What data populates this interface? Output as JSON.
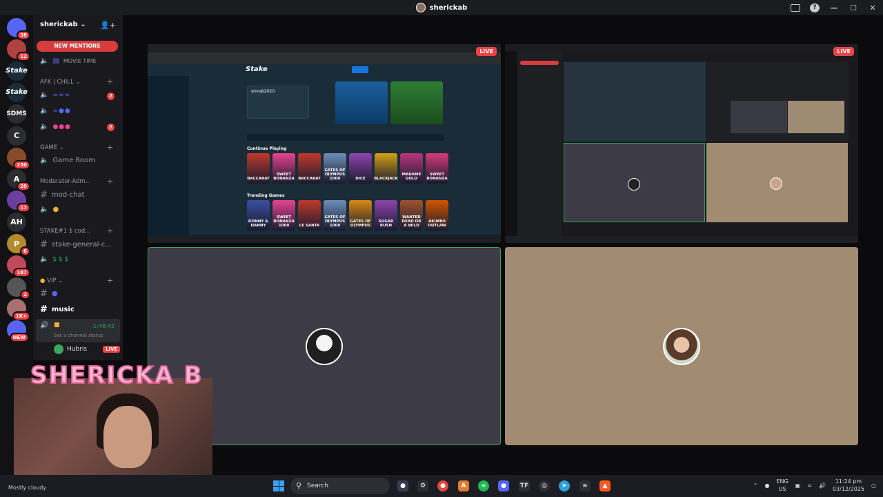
{
  "window": {
    "title": "sherickab"
  },
  "server": {
    "name": "sherickab",
    "new_mentions": "NEW MENTIONS"
  },
  "rail": [
    {
      "label": "",
      "badge": "38",
      "color": "#5865f2"
    },
    {
      "label": "",
      "badge": "12",
      "color": "#b34040"
    },
    {
      "label": "Stake",
      "badge": "",
      "color": "#1a2c38"
    },
    {
      "label": "Stake",
      "badge": "",
      "color": "#1a2c38"
    },
    {
      "label": "SDMS",
      "badge": "",
      "color": "#2b2d31"
    },
    {
      "label": "C",
      "badge": "",
      "color": "#2b2d31"
    },
    {
      "label": "",
      "badge": "230",
      "color": "#8a4b2b"
    },
    {
      "label": "A",
      "badge": "20",
      "color": "#2b2d31"
    },
    {
      "label": "",
      "badge": "17",
      "color": "#6b3fa0"
    },
    {
      "label": "AH",
      "badge": "",
      "color": "#2b2d31"
    },
    {
      "label": "P",
      "badge": "6",
      "color": "#b48a2a"
    },
    {
      "label": "",
      "badge": "187",
      "color": "#c04a5a"
    },
    {
      "label": "",
      "badge": "2",
      "color": "#555"
    },
    {
      "label": "",
      "badge": "1K+",
      "color": "#a87070"
    },
    {
      "label": "",
      "badge": "NEW",
      "color": "#5865f2"
    }
  ],
  "channels": {
    "movie_time": "MOVIE TIME",
    "afk_category": "AFK | CHILL",
    "game_category": "GAME",
    "game_room": "Game Room",
    "mod_category": "Moderator-Adm...",
    "mod_chat": "mod-chat",
    "stake_category": "STAKE#1 $ cod...",
    "stake_general": "stake-general-c...",
    "vip_category": "VIP",
    "music": "music",
    "timer": "1:48:43",
    "channel_status": "Set a channel status",
    "hubris_name": "Hubris",
    "hubris_live": "LIVE",
    "afk_badge_1": "2",
    "afk_badge_2": "2"
  },
  "streams": {
    "live_label": "LIVE",
    "stake_username": "smrab2020",
    "continue_playing": "Continue Playing",
    "trending": "Trending Games",
    "games_row1": [
      {
        "name": "BACCARAT",
        "color": "#c0392b"
      },
      {
        "name": "SWEET BONANZA",
        "color": "#e84393"
      },
      {
        "name": "BACCARAT",
        "color": "#c0392b"
      },
      {
        "name": "GATES OF OLYMPUS 1000",
        "color": "#6c8fb8"
      },
      {
        "name": "DICE",
        "color": "#8e44ad"
      },
      {
        "name": "BLACKJACK",
        "color": "#d4a017"
      },
      {
        "name": "MADAME GOLD",
        "color": "#b8367d"
      },
      {
        "name": "SWEET BONANZA",
        "color": "#d63a7a"
      }
    ],
    "games_row2": [
      {
        "name": "DONNY & DANNY",
        "color": "#3a4fa0"
      },
      {
        "name": "SWEET BONANZA 1000",
        "color": "#e84393"
      },
      {
        "name": "LE SANTA",
        "color": "#c0392b"
      },
      {
        "name": "GATES OF OLYMPUS 1000",
        "color": "#6c8fb8"
      },
      {
        "name": "GATES OF OLYMPUS",
        "color": "#d68910"
      },
      {
        "name": "SUGAR RUSH",
        "color": "#8e44ad"
      },
      {
        "name": "WANTED DEAD OR A WILD",
        "color": "#a0522d"
      },
      {
        "name": "AKIMBO OUTLAW",
        "color": "#d35400"
      }
    ]
  },
  "webcam": {
    "title": "SHERICKA B"
  },
  "taskbar": {
    "weather": "Mostly cloudy",
    "search": "Search",
    "lang_top": "ENG",
    "lang_bottom": "US",
    "time": "11:24 pm",
    "date": "03/12/2025"
  },
  "colors": {
    "accent": "#5865f2",
    "live": "#ed4245",
    "online": "#23a55a"
  }
}
